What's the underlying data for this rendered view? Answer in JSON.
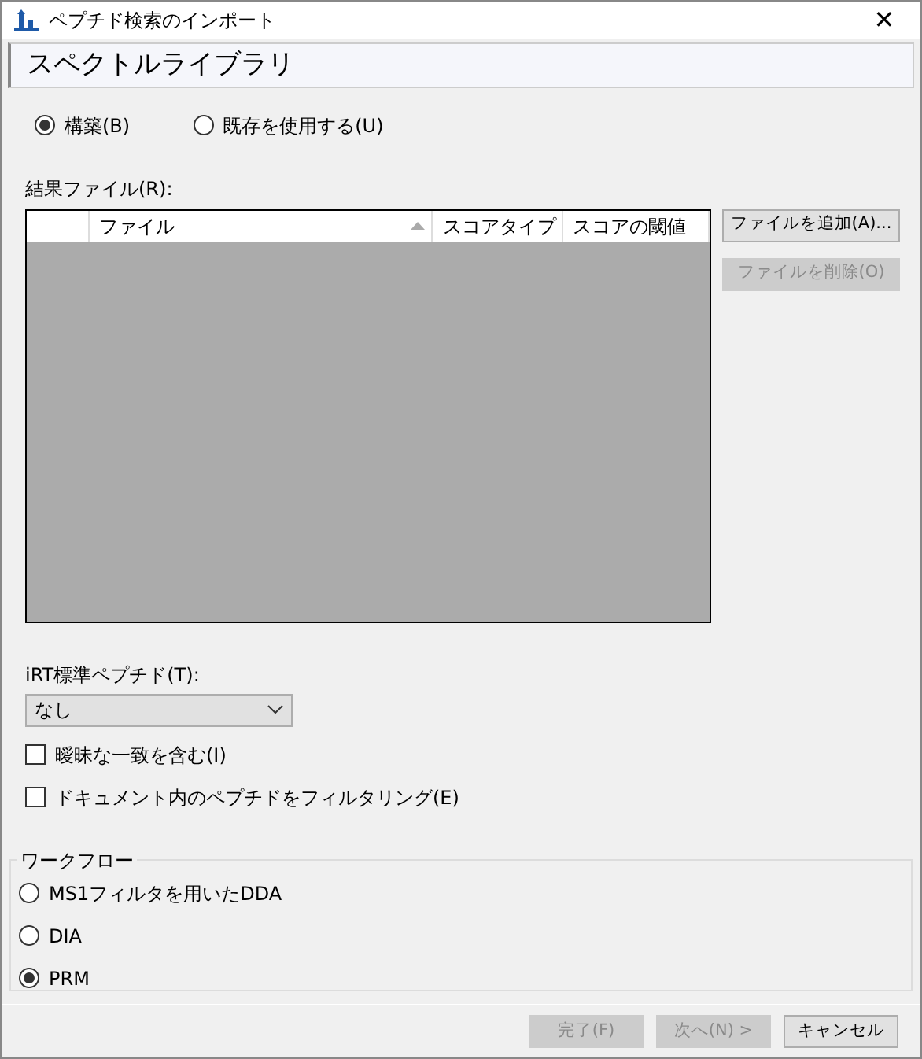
{
  "window": {
    "title": "ペプチド検索のインポート",
    "close": "✕"
  },
  "header": {
    "title": "スペクトルライブラリ"
  },
  "source_options": [
    {
      "label": "構築(B)",
      "selected": true
    },
    {
      "label": "既存を使用する(U)",
      "selected": false
    }
  ],
  "results": {
    "label": "結果ファイル(R):",
    "columns": [
      {
        "label": "ファイル",
        "sorted": true
      },
      {
        "label": "スコアタイプ",
        "sorted": false
      },
      {
        "label": "スコアの閾値",
        "sorted": false
      }
    ],
    "buttons": [
      {
        "label": "ファイルを追加(A)...",
        "disabled": false
      },
      {
        "label": "ファイルを削除(O)",
        "disabled": true
      }
    ]
  },
  "irt": {
    "label": "iRT標準ペプチド(T):",
    "value": "なし"
  },
  "checkboxes": [
    {
      "label": "曖昧な一致を含む(I)",
      "checked": false
    },
    {
      "label": "ドキュメント内のペプチドをフィルタリング(E)",
      "checked": false
    }
  ],
  "workflow": {
    "title": "ワークフロー",
    "options": [
      {
        "label": "MS1フィルタを用いたDDA",
        "selected": false
      },
      {
        "label": "DIA",
        "selected": false
      },
      {
        "label": "PRM",
        "selected": true
      }
    ]
  },
  "footer_buttons": [
    {
      "label": "完了(F)",
      "disabled": true
    },
    {
      "label": "次へ(N) >",
      "disabled": true
    },
    {
      "label": "キャンセル",
      "disabled": false
    }
  ]
}
